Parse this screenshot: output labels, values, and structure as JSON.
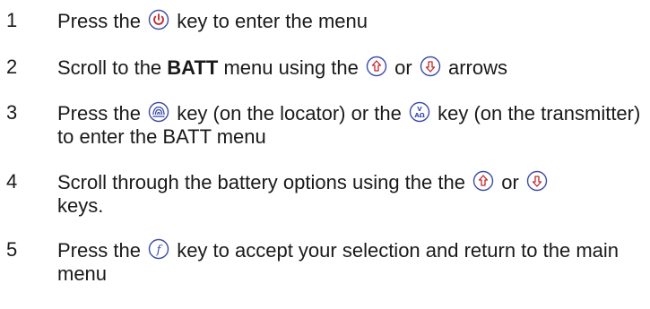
{
  "steps": [
    {
      "number": "1",
      "before_icon": "Press the",
      "icon": "power-icon",
      "after_icon": "key to enter the menu"
    },
    {
      "number": "2",
      "prefix": "Scroll to the",
      "bold": "BATT",
      "middle": "menu using the",
      "icon_a": "up-arrow-icon",
      "connector": "or",
      "icon_b": "down-arrow-icon",
      "suffix": "arrows"
    },
    {
      "number": "3",
      "prefix": "Press the",
      "icon_a": "locator-key-icon",
      "middle": "key (on the locator) or the",
      "icon_b": "transmitter-key-icon",
      "suffix": "key (on the transmitter) to enter the BATT menu"
    },
    {
      "number": "4",
      "prefix": "Scroll through the battery options using the the",
      "icon_a": "up-arrow-icon",
      "connector": "or",
      "icon_b": "down-arrow-icon",
      "suffix": "keys."
    },
    {
      "number": "5",
      "prefix": "Press the",
      "icon": "function-key-icon",
      "suffix": "key to accept your selection and return to the main menu"
    }
  ],
  "colors": {
    "text": "#1a1a1a",
    "icon_stroke": "#3b4ba8"
  }
}
